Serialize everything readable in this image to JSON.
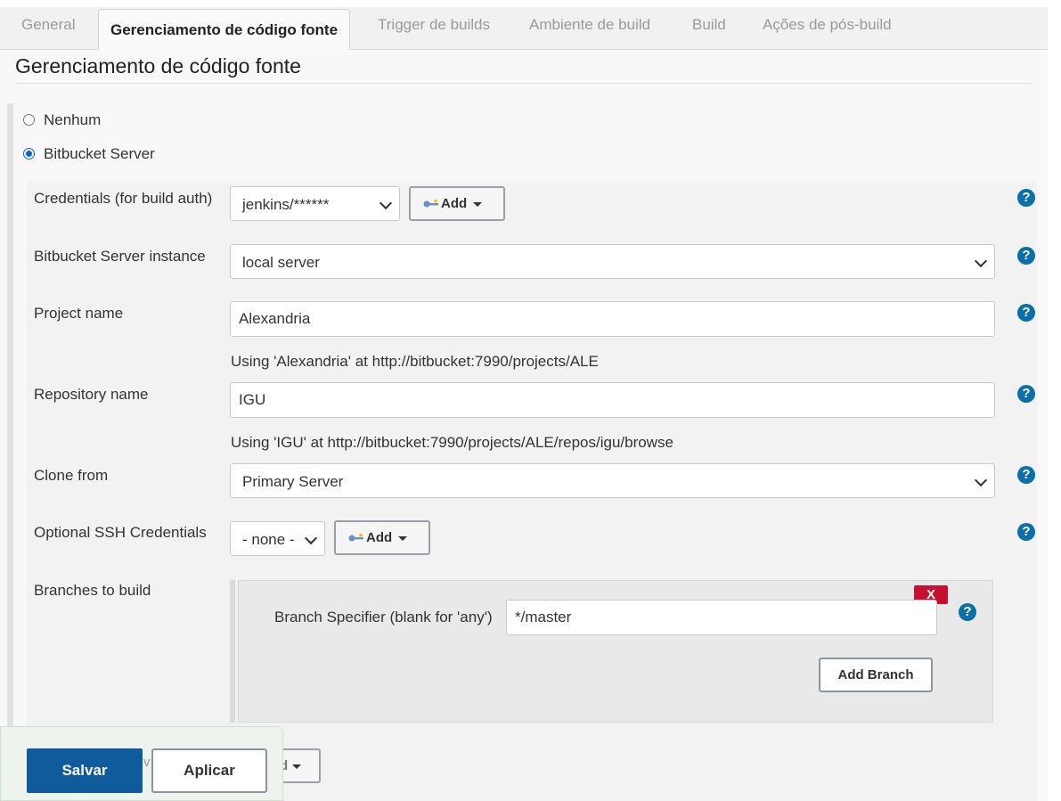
{
  "tabs": [
    {
      "label": "General"
    },
    {
      "label": "Gerenciamento de código fonte"
    },
    {
      "label": "Trigger de builds"
    },
    {
      "label": "Ambiente de build"
    },
    {
      "label": "Build"
    },
    {
      "label": "Ações de pós-build"
    }
  ],
  "active_tab": "Gerenciamento de código fonte",
  "section": {
    "title": "Gerenciamento de código fonte"
  },
  "scm_options": [
    {
      "label": "Nenhum",
      "selected": false
    },
    {
      "label": "Bitbucket Server",
      "selected": true
    }
  ],
  "form": {
    "credentials": {
      "label": "Credentials (for build auth)",
      "value": "jenkins/******",
      "add_label": "Add"
    },
    "server_instance": {
      "label": "Bitbucket Server instance",
      "value": "local server"
    },
    "project": {
      "label": "Project name",
      "value": "Alexandria",
      "hint": "Using 'Alexandria' at http://bitbucket:7990/projects/ALE"
    },
    "repository": {
      "label": "Repository name",
      "value": "IGU",
      "hint": "Using 'IGU' at http://bitbucket:7990/projects/ALE/repos/igu/browse"
    },
    "clone_from": {
      "label": "Clone from",
      "value": "Primary Server"
    },
    "ssh_credentials": {
      "label": "Optional SSH Credentials",
      "value": "- none -",
      "add_label": "Add"
    },
    "branches": {
      "label": "Branches to build",
      "specifier_label": "Branch Specifier (blank for 'any')",
      "specifier_value": "*/master",
      "delete_label": "X",
      "add_branch_label": "Add Branch"
    },
    "partial_add_label": "Add",
    "partial_left_label": "v"
  },
  "help_symbol": "?",
  "actions": {
    "save_label": "Salvar",
    "apply_label": "Aplicar"
  },
  "colors": {
    "primary": "#105b9c",
    "help": "#0b6fa8",
    "delete": "#c8102e",
    "radio": "#0b63d1"
  },
  "icons": [
    "key-icon",
    "help-icon",
    "chevron-down-icon",
    "caret-down-icon"
  ]
}
